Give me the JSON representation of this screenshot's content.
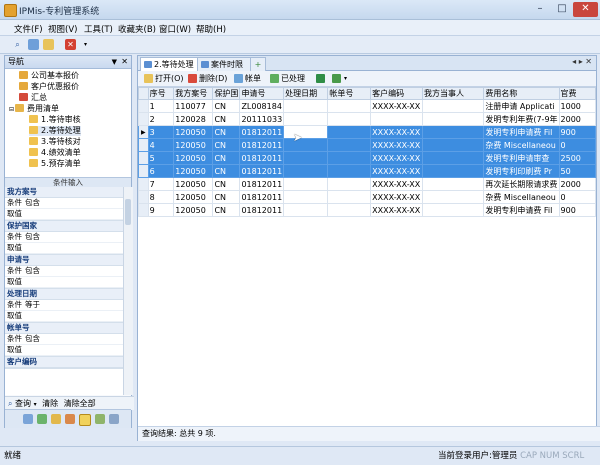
{
  "window": {
    "title": "IPMis-专利管理系统"
  },
  "menu": [
    "文件(F)",
    "视图(V)",
    "工具(T)",
    "收藏夹(B)",
    "窗口(W)",
    "帮助(H)"
  ],
  "side": {
    "title": "导航",
    "tree": [
      {
        "label": "公司基本报价"
      },
      {
        "label": "客户优惠报价"
      },
      {
        "label": "汇总"
      },
      {
        "label": "费用清单"
      },
      {
        "label": "1.等待审核"
      },
      {
        "label": "2.等待处理"
      },
      {
        "label": "3.等待核对"
      },
      {
        "label": "4.绩效清单"
      },
      {
        "label": "5.预存清单"
      }
    ],
    "conditions_title": "条件输入",
    "groups": [
      {
        "title": "我方案号",
        "cond_label": "条件",
        "cond_value": "包含",
        "val_label": "取值"
      },
      {
        "title": "保护国家",
        "cond_label": "条件",
        "cond_value": "包含",
        "val_label": "取值"
      },
      {
        "title": "申请号",
        "cond_label": "条件",
        "cond_value": "包含",
        "val_label": "取值"
      },
      {
        "title": "处理日期",
        "cond_label": "条件",
        "cond_value": "等于",
        "val_label": "取值"
      },
      {
        "title": "帐单号",
        "cond_label": "条件",
        "cond_value": "包含",
        "val_label": "取值"
      },
      {
        "title": "客户编码"
      }
    ],
    "query": {
      "search": "查询",
      "clear": "清除",
      "clear_all": "清除全部"
    }
  },
  "tabs": [
    "2.等待处理",
    "案件时限"
  ],
  "subtoolbar": [
    "打开(O)",
    "删除(D)",
    "帐单",
    "已处理"
  ],
  "grid": {
    "headers": [
      "序号",
      "我方案号",
      "保护国",
      "申请号",
      "处理日期",
      "帐单号",
      "客户编码",
      "我方当事人",
      "费用名称",
      "官费"
    ],
    "rows": [
      [
        "1",
        "110077",
        "CN",
        "ZL008184",
        "",
        "",
        "XXXX-XX-XX",
        "",
        "注册申请 Applicati",
        "1000"
      ],
      [
        "2",
        "120028",
        "CN",
        "20111033",
        "",
        "",
        "",
        "",
        "发明专利年费(7-9年",
        "2000"
      ],
      [
        "3",
        "120050",
        "CN",
        "01812011",
        "",
        "",
        "XXXX-XX-XX",
        "",
        "发明专利申请费 Fil",
        "900"
      ],
      [
        "4",
        "120050",
        "CN",
        "01812011",
        "",
        "",
        "XXXX-XX-XX",
        "",
        "杂费 Miscellaneou",
        "0"
      ],
      [
        "5",
        "120050",
        "CN",
        "01812011",
        "",
        "",
        "XXXX-XX-XX",
        "",
        "发明专利申请审查",
        "2500"
      ],
      [
        "6",
        "120050",
        "CN",
        "01812011",
        "",
        "",
        "XXXX-XX-XX",
        "",
        "发明专利印刷费 Pr",
        "50"
      ],
      [
        "7",
        "120050",
        "CN",
        "01812011",
        "",
        "",
        "XXXX-XX-XX",
        "",
        "再次延长期限请求费",
        "2000"
      ],
      [
        "8",
        "120050",
        "CN",
        "01812011",
        "",
        "",
        "XXXX-XX-XX",
        "",
        "杂费 Miscellaneou",
        "0"
      ],
      [
        "9",
        "120050",
        "CN",
        "01812011",
        "",
        "",
        "XXXX-XX-XX",
        "",
        "发明专利申请费 Fil",
        "900"
      ]
    ]
  },
  "footer": "查询结果: 总共 9 项.",
  "status": {
    "left": "就绪",
    "right": "当前登录用户:管理员",
    "caps": "CAP NUM SCRL"
  }
}
